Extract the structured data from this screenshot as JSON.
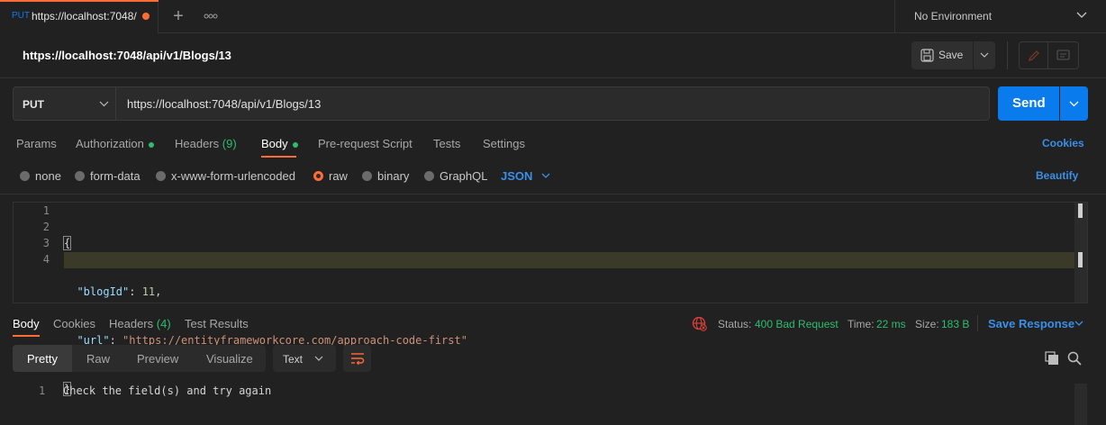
{
  "tab": {
    "method": "PUT",
    "url_short": "https://localhost:7048/",
    "new_tab": "+",
    "more": "ooo"
  },
  "environment": {
    "label": "No Environment"
  },
  "request": {
    "title": "https://localhost:7048/api/v1/Blogs/13",
    "save_label": "Save",
    "method": "PUT",
    "url": "https://localhost:7048/api/v1/Blogs/13",
    "send_label": "Send"
  },
  "req_tabs": {
    "params": "Params",
    "authorization": "Authorization",
    "headers": "Headers",
    "headers_count": "(9)",
    "body": "Body",
    "prerequest": "Pre-request Script",
    "tests": "Tests",
    "settings": "Settings",
    "cookies": "Cookies"
  },
  "body_types": {
    "none": "none",
    "form_data": "form-data",
    "urlencoded": "x-www-form-urlencoded",
    "raw": "raw",
    "binary": "binary",
    "graphql": "GraphQL",
    "format": "JSON",
    "beautify": "Beautify"
  },
  "editor": {
    "line_numbers": [
      "1",
      "2",
      "3",
      "4"
    ],
    "open_brace": "{",
    "key1": "\"blogId\"",
    "colon1": ": ",
    "val1": "11",
    "comma1": ",",
    "key2": "\"url\"",
    "colon2": ": ",
    "val2": "\"https://entityframeworkcore.com/approach-code-first\"",
    "close_brace": "}"
  },
  "response": {
    "tabs": {
      "body": "Body",
      "cookies": "Cookies",
      "headers": "Headers",
      "headers_count": "(4)",
      "test_results": "Test Results"
    },
    "status_label": "Status:",
    "status_value": "400 Bad Request",
    "time_label": "Time:",
    "time_value": "22 ms",
    "size_label": "Size:",
    "size_value": "183 B",
    "save_response": "Save Response",
    "views": {
      "pretty": "Pretty",
      "raw": "Raw",
      "preview": "Preview",
      "visualize": "Visualize"
    },
    "format": "Text",
    "line_number": "1",
    "line_text": "Check the field(s) and try again"
  },
  "colors": {
    "accent": "#ff6c37",
    "send": "#097bed",
    "link": "#3a8fe8",
    "status_ok_green": "#2dbd6e",
    "json_key": "#9cdcfe",
    "json_string": "#ce9178"
  }
}
